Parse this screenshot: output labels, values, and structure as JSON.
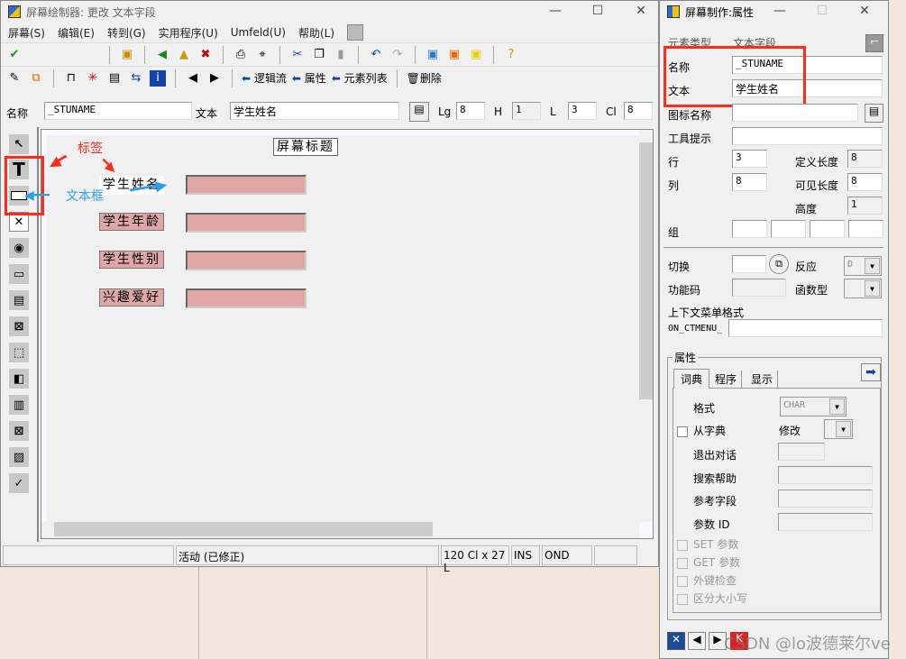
{
  "main_window": {
    "title": "屏幕绘制器:  更改 文本字段",
    "menu": [
      "屏幕(S)",
      "编辑(E)",
      "转到(G)",
      "实用程序(U)",
      "Umfeld(U)",
      "帮助(L)"
    ],
    "toolbar2": {
      "logic_flow": "逻辑流",
      "attributes": "属性",
      "element_list": "元素列表",
      "delete": "删除"
    },
    "fieldbar": {
      "name_label": "名称",
      "name_value": "_STUNAME",
      "text_label": "文本",
      "text_value": "学生姓名",
      "lg_label": "Lg",
      "lg_value": "8",
      "h_label": "H",
      "h_value": "1",
      "l_label": "L",
      "l_value": "3",
      "cl_label": "Cl",
      "cl_value": "8"
    },
    "canvas": {
      "screen_title": "屏幕标题",
      "labels": [
        "学生姓名",
        "学生年龄",
        "学生性别",
        "兴趣爱好"
      ]
    },
    "annotations": {
      "label_note": "标签",
      "textbox_note": "文本框"
    },
    "status": {
      "mode": "活动 (已修正)",
      "size": "120 Cl x 27 L",
      "ins": "INS",
      "ond": "OND"
    }
  },
  "props_window": {
    "title": "屏幕制作:属性",
    "element_type_label": "元素类型",
    "element_type_value": "文本字段",
    "name_label": "名称",
    "name_value": "_STUNAME",
    "text_label": "文本",
    "text_value": "学生姓名",
    "icon_name_label": "图标名称",
    "tooltip_label": "工具提示",
    "row_label": "行",
    "row_value": "3",
    "col_label": "列",
    "col_value": "8",
    "def_len_label": "定义长度",
    "def_len_value": "8",
    "vis_len_label": "可见长度",
    "vis_len_value": "8",
    "height_label": "高度",
    "height_value": "1",
    "group_label": "组",
    "switch_label": "切换",
    "response_label": "反应",
    "response_value": "D",
    "fcode_label": "功能码",
    "ftype_label": "函数型",
    "ctx_menu_label": "上下文菜单格式",
    "ctx_prefix": "ON_CTMENU_",
    "attr_group": "属性",
    "tabs": [
      "词典",
      "程序",
      "显示"
    ],
    "format_label": "格式",
    "format_value": "CHAR",
    "from_dict": "从字典",
    "modify_label": "修改",
    "exit_dialog": "退出对话",
    "search_help": "搜索帮助",
    "ref_field": "参考字段",
    "param_id": "参数 ID",
    "set_param": "SET 参数",
    "get_param": "GET 参数",
    "fk_check": "外键检查",
    "case": "区分大小写"
  },
  "watermark": "CSDN @lo波德莱尔ve",
  "colors": {
    "field_fill": "#e0a5a5",
    "highlight": "#ff2a1a",
    "annotation_blue": "#2aa0f0"
  }
}
